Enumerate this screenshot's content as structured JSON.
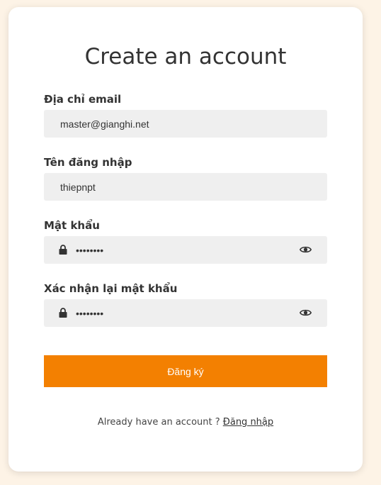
{
  "form": {
    "title": "Create an account",
    "email": {
      "label": "Địa chỉ email",
      "value": "master@gianghi.net"
    },
    "username": {
      "label": "Tên đăng nhập",
      "value": "thiepnpt"
    },
    "password": {
      "label": "Mật khẩu",
      "value": "thiepnpt",
      "icon": "lock-icon",
      "toggle_icon": "eye-icon"
    },
    "confirm_password": {
      "label": "Xác nhận lại mật khẩu",
      "value": "thiepnpt",
      "icon": "lock-icon",
      "toggle_icon": "eye-icon"
    },
    "submit_label": "Đăng ký",
    "footer_text": "Already have an account ? ",
    "login_link": "Đăng nhập"
  },
  "colors": {
    "page_background": "#fdf3e6",
    "card_background": "#ffffff",
    "field_background": "#efefef",
    "accent": "#f38001"
  }
}
